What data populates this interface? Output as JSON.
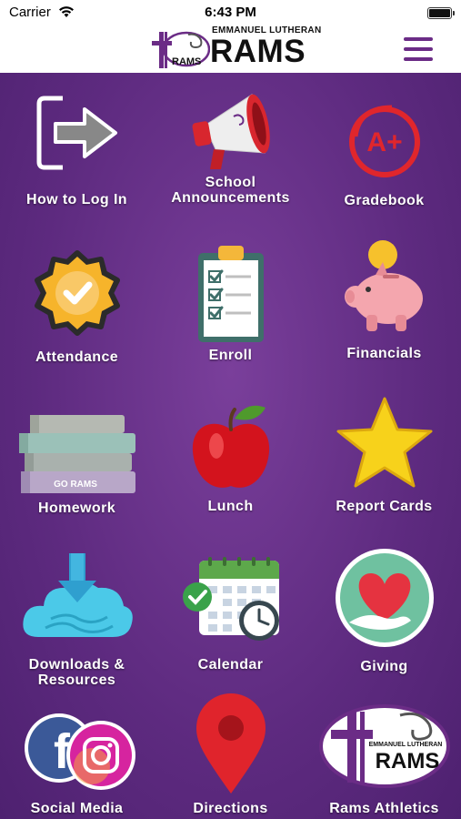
{
  "status_bar": {
    "carrier": "Carrier",
    "time": "6:43 PM",
    "wifi_icon": "wifi-icon",
    "battery_icon": "battery-icon"
  },
  "header": {
    "logo_line": "EMMANUEL LUTHERAN",
    "logo_main": "RAMS",
    "logo_badge": "RAMS",
    "menu_icon": "hamburger-menu-icon"
  },
  "colors": {
    "background": "#5d2a7f",
    "accent": "#6b2c86",
    "label": "#ffffff"
  },
  "tiles": [
    {
      "label_line1": "How to Log In",
      "label_line2": "",
      "icon": "login-arrow-icon"
    },
    {
      "label_line1": "School",
      "label_line2": "Announcements",
      "icon": "megaphone-icon"
    },
    {
      "label_line1": "Gradebook",
      "label_line2": "",
      "icon": "a-plus-grade-icon",
      "grade": "A+"
    },
    {
      "label_line1": "Attendance",
      "label_line2": "",
      "icon": "checkmark-badge-icon"
    },
    {
      "label_line1": "Enroll",
      "label_line2": "",
      "icon": "clipboard-checklist-icon"
    },
    {
      "label_line1": "Financials",
      "label_line2": "",
      "icon": "piggy-bank-icon"
    },
    {
      "label_line1": "Homework",
      "label_line2": "",
      "icon": "books-stack-icon",
      "book_text": "GO RAMS"
    },
    {
      "label_line1": "Lunch",
      "label_line2": "",
      "icon": "apple-icon"
    },
    {
      "label_line1": "Report Cards",
      "label_line2": "",
      "icon": "star-icon"
    },
    {
      "label_line1": "Downloads &",
      "label_line2": "Resources",
      "icon": "cloud-download-icon"
    },
    {
      "label_line1": "Calendar",
      "label_line2": "",
      "icon": "calendar-clock-icon"
    },
    {
      "label_line1": "Giving",
      "label_line2": "",
      "icon": "heart-hand-icon"
    },
    {
      "label_line1": "Social Media",
      "label_line2": "",
      "icon": "facebook-instagram-icon"
    },
    {
      "label_line1": "Directions",
      "label_line2": "",
      "icon": "map-pin-icon"
    },
    {
      "label_line1": "Rams Athletics",
      "label_line2": "",
      "icon": "rams-logo-icon",
      "logo_line": "EMMANUEL LUTHERAN",
      "logo_main": "RAMS"
    }
  ]
}
